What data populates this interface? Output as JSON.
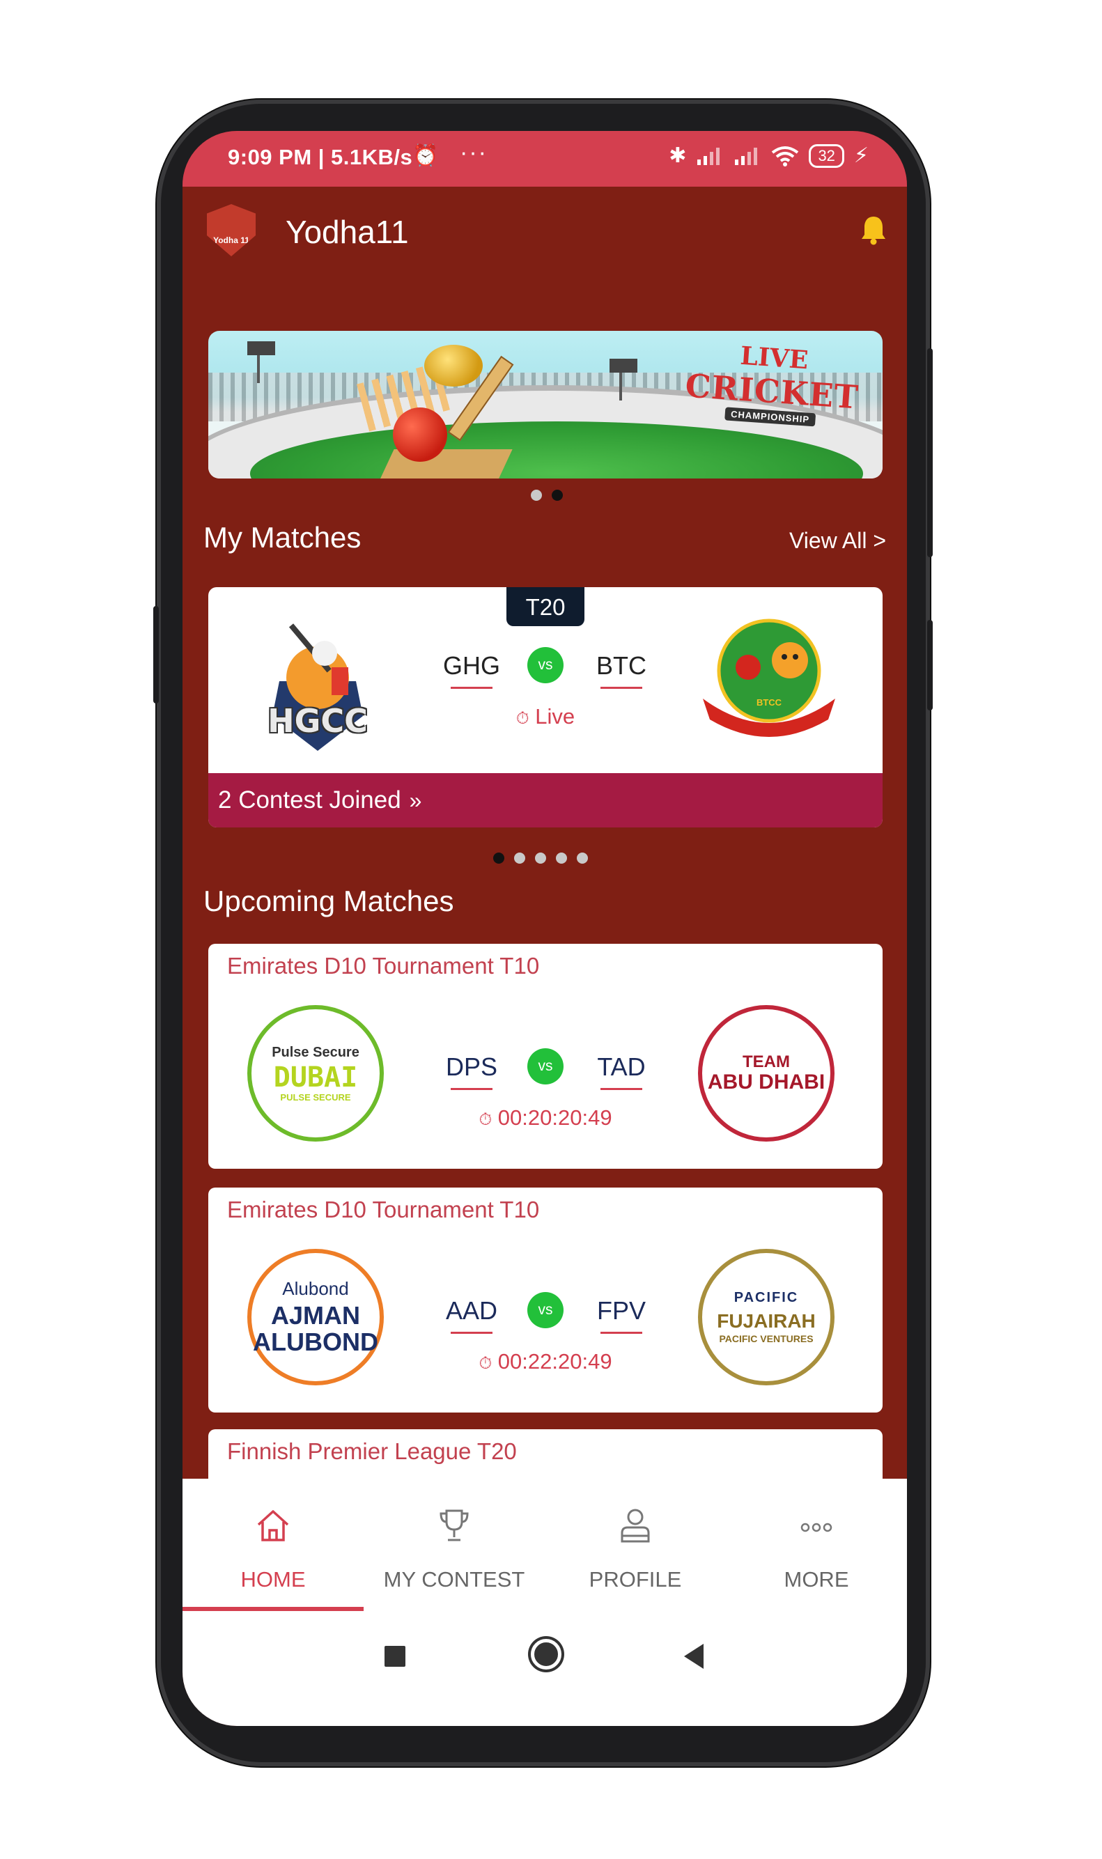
{
  "status_bar": {
    "time": "9:09 PM | 5.1KB/s",
    "battery": "32"
  },
  "header": {
    "app_title": "Yodha11",
    "logo_text": "Yodha 11"
  },
  "banner": {
    "line1": "LIVE",
    "line2": "CRICKET",
    "line3": "CHAMPIONSHIP"
  },
  "my_matches": {
    "title": "My Matches",
    "view_all": "View All >",
    "match": {
      "format": "T20",
      "team1_code": "GHG",
      "team1_logo_text": "HGCC",
      "team2_code": "BTC",
      "team2_logo_text": "BTCC",
      "vs": "vs",
      "status": "Live",
      "contest_text": "2 Contest Joined"
    }
  },
  "upcoming": {
    "title": "Upcoming Matches",
    "matches": [
      {
        "tournament": "Emirates D10 Tournament T10",
        "team1_code": "DPS",
        "team1_logo": {
          "top": "Pulse Secure",
          "main": "DUBAI",
          "sub": "PULSE SECURE"
        },
        "team2_code": "TAD",
        "team2_logo": {
          "top": "TEAM",
          "main": "ABU DHABI"
        },
        "vs": "vs",
        "countdown": "00:20:20:49"
      },
      {
        "tournament": "Emirates D10 Tournament T10",
        "team1_code": "AAD",
        "team1_logo": {
          "top": "Alubond",
          "main": "AJMAN",
          "sub": "ALUBOND"
        },
        "team2_code": "FPV",
        "team2_logo": {
          "top": "PACIFIC",
          "main": "FUJAIRAH",
          "sub": "PACIFIC VENTURES"
        },
        "vs": "vs",
        "countdown": "00:22:20:49"
      },
      {
        "tournament": "Finnish Premier League T20"
      }
    ]
  },
  "bottom_nav": {
    "items": [
      {
        "label": "HOME",
        "icon": "home-icon",
        "active": true
      },
      {
        "label": "MY CONTEST",
        "icon": "trophy-icon",
        "active": false
      },
      {
        "label": "PROFILE",
        "icon": "profile-icon",
        "active": false
      },
      {
        "label": "MORE",
        "icon": "more-icon",
        "active": false
      }
    ]
  },
  "colors": {
    "app_bg": "#7f1f14",
    "status_bar": "#d43f4f",
    "accent": "#d43f4f",
    "contest_bar": "#a51b43",
    "vs_badge": "#22c03a"
  }
}
